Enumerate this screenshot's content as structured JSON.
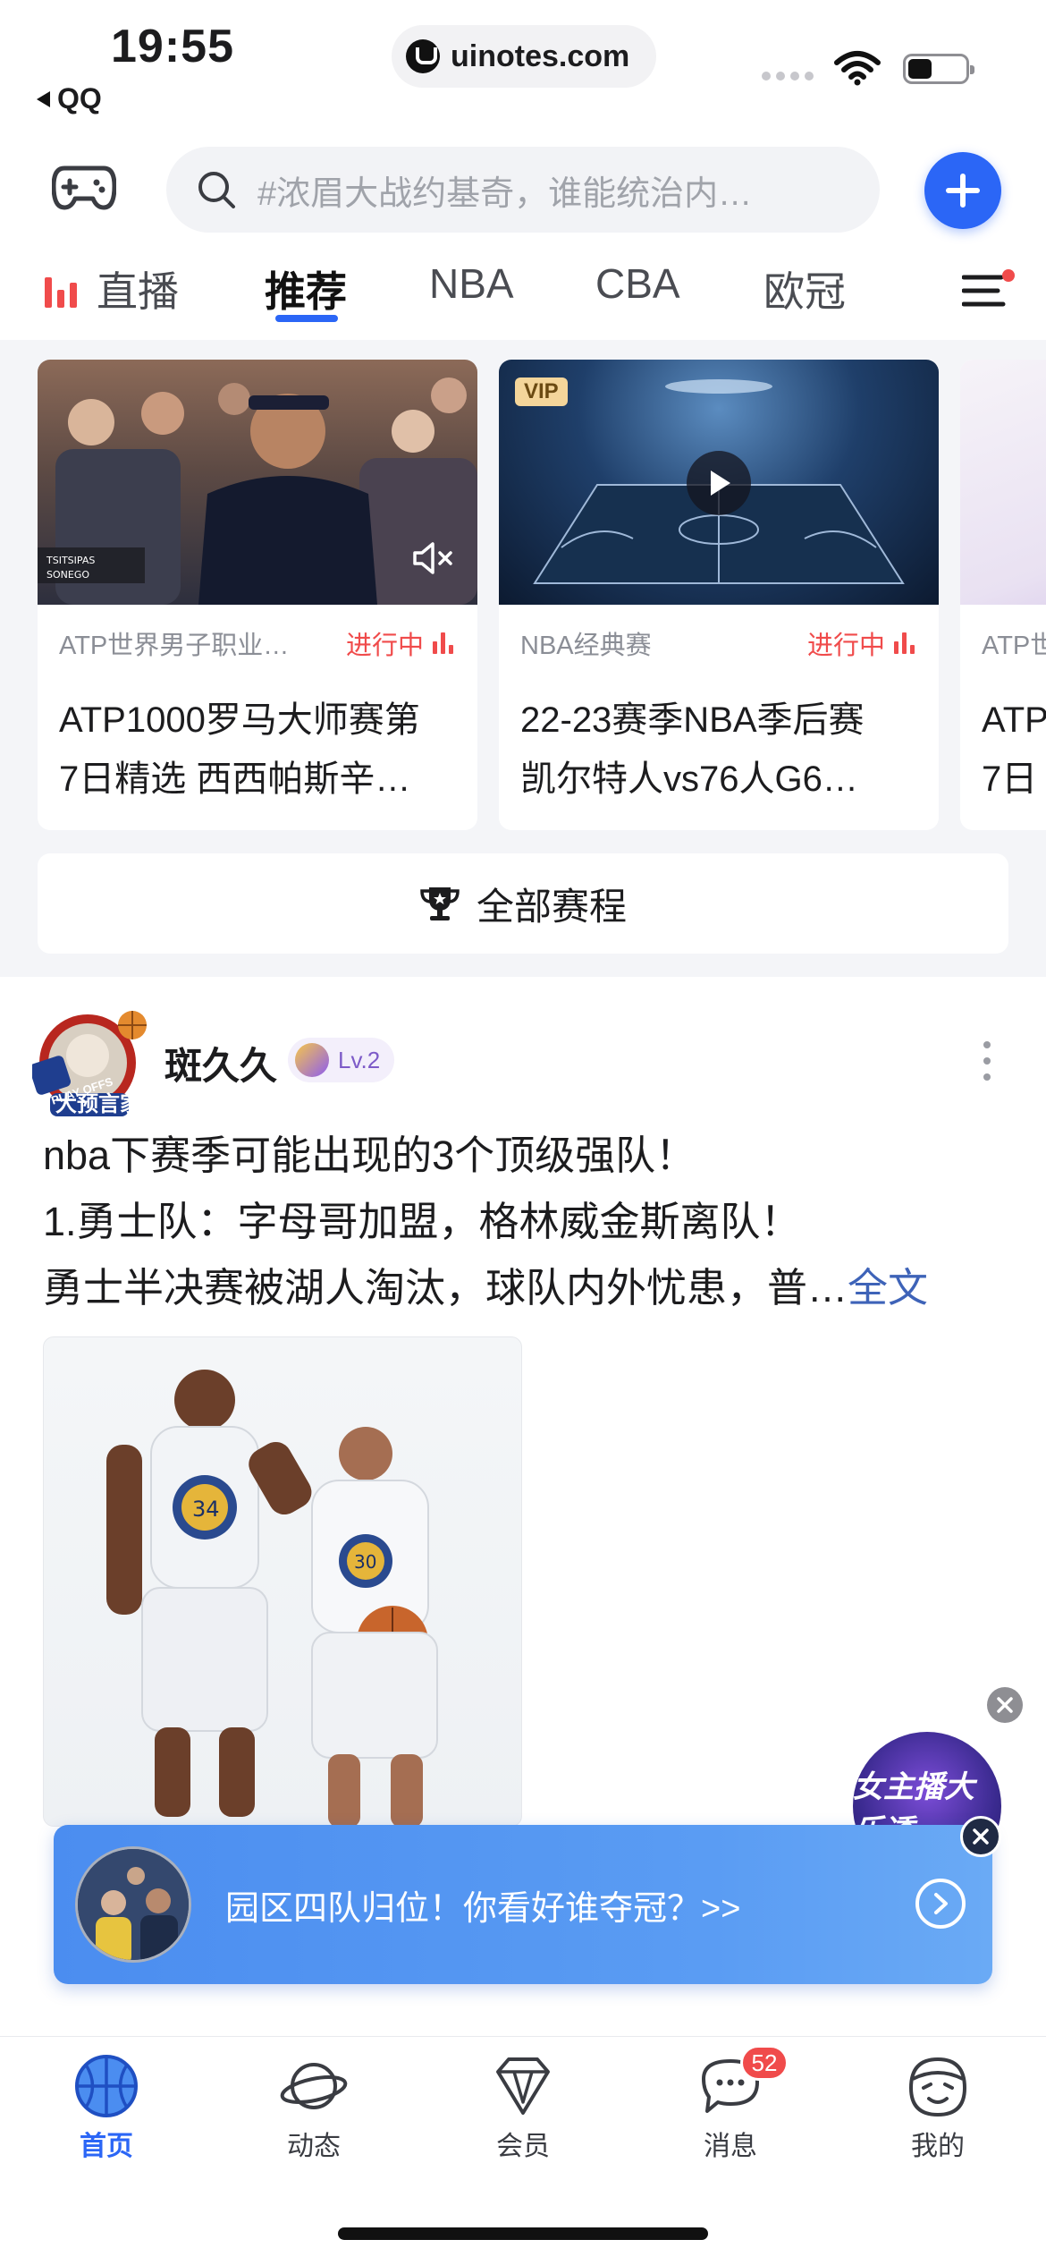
{
  "status_bar": {
    "time": "19:55",
    "back_app": "QQ",
    "url": "uinotes.com"
  },
  "header": {
    "search_placeholder": "#浓眉大战约基奇，谁能统治内…",
    "accent_color": "#2b66f6"
  },
  "tabs": [
    {
      "label": "直播",
      "active": false
    },
    {
      "label": "推荐",
      "active": true
    },
    {
      "label": "NBA",
      "active": false
    },
    {
      "label": "CBA",
      "active": false
    },
    {
      "label": "欧冠",
      "active": false
    }
  ],
  "match_cards": [
    {
      "category": "ATP世界男子职业…",
      "status": "进行中",
      "title_line1": "ATP1000罗马大师赛第",
      "title_line2": "7日精选 西西帕斯辛…"
    },
    {
      "category": "NBA经典赛",
      "status": "进行中",
      "badge": "VIP",
      "title_line1": "22-23赛季NBA季后赛",
      "title_line2": "凯尔特人vs76人G6…"
    },
    {
      "category": "ATP世",
      "title_line1": "ATP",
      "title_line2": "7日"
    }
  ],
  "schedule_button": "全部赛程",
  "post": {
    "avatar_label": "大预言家",
    "username": "斑久久",
    "level": "Lv.2",
    "line1": "nba下赛季可能出现的3个顶级强队！",
    "line2": "1.勇士队：字母哥加盟，格林威金斯离队！",
    "line3": "勇士半决赛被湖人淘汰，球队内外忧患，普…",
    "read_more": "全文"
  },
  "float_widget": {
    "label": "女主播大乐透"
  },
  "banner": {
    "text": "园区四队归位！你看好谁夺冠？>>"
  },
  "bottom_nav": [
    {
      "label": "首页",
      "icon": "basketball-icon",
      "active": true
    },
    {
      "label": "动态",
      "icon": "planet-icon",
      "active": false
    },
    {
      "label": "会员",
      "icon": "diamond-icon",
      "active": false
    },
    {
      "label": "消息",
      "icon": "chat-bubble-icon",
      "active": false,
      "badge": "52"
    },
    {
      "label": "我的",
      "icon": "profile-face-icon",
      "active": false
    }
  ]
}
